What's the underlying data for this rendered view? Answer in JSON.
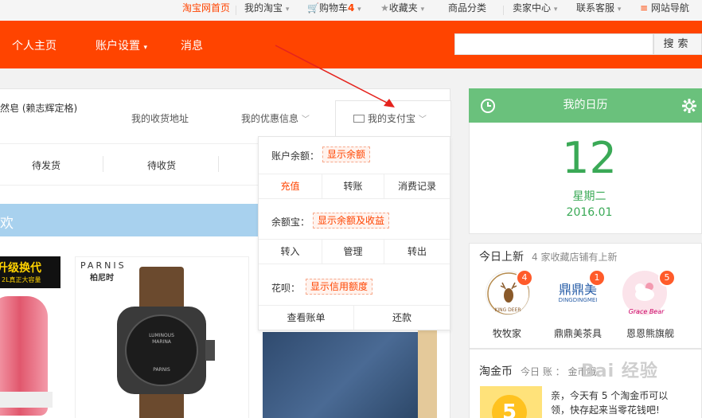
{
  "topbar": {
    "home": "淘宝网首页",
    "my_taobao": "我的淘宝",
    "cart": "购物车",
    "cart_count": "4",
    "favorites": "收藏夹",
    "categories": "商品分类",
    "seller": "卖家中心",
    "support": "联系客服",
    "sitenav": "网站导航"
  },
  "nav": {
    "home": "个人主页",
    "settings": "账户设置",
    "messages": "消息",
    "search_value": "",
    "search_button": "搜索"
  },
  "profile": {
    "username": "然皂 (赖志辉定格)",
    "tabs": [
      "我的收货地址",
      "我的优惠信息",
      "我的支付宝"
    ]
  },
  "orders": [
    "待发货",
    "待收货"
  ],
  "banner_text": "欢",
  "alipay_dropdown": {
    "balance_label": "账户余额：",
    "balance_badge": "显示余额",
    "balance_actions": [
      "充值",
      "转账",
      "消费记录"
    ],
    "yuebao_label": "余额宝：",
    "yuebao_badge": "显示余额及收益",
    "yuebao_actions": [
      "转入",
      "管理",
      "转出"
    ],
    "huabei_label": "花呗：",
    "huabei_badge": "显示信用额度",
    "huabei_actions": [
      "查看账单",
      "还款"
    ]
  },
  "products": {
    "p1_text": "升级换代",
    "p1_sub": "2L真正大容量",
    "p2_brand": "PARNIS",
    "p2_brand_cn": "柏尼时",
    "p2_dial1": "LUMINOUS",
    "p2_dial2": "MARINA",
    "p2_dial3": "PARNIS"
  },
  "calendar": {
    "title": "我的日历",
    "day": "12",
    "weekday": "星期二",
    "year_month": "2016.01"
  },
  "new_today": {
    "title": "今日上新",
    "subtitle": "4 家收藏店铺有上新",
    "shops": [
      {
        "name": "牧牧家",
        "count": "4",
        "logo": "KING DEER"
      },
      {
        "name": "鼎鼎美茶具",
        "count": "1",
        "logo_cn": "鼎鼎美",
        "logo": "DINGDINGMEI"
      },
      {
        "name": "恩恩熊旗舰",
        "count": "5",
        "logo": "Grace Bear"
      }
    ]
  },
  "coins": {
    "title": "淘金币",
    "sub": "今日  账   ：   金币哦",
    "line1": "亲，今天有 5 个淘金币可以",
    "line1_highlight": "5",
    "line2": "领，快存起来当零花钱吧!",
    "badge": "5"
  },
  "watermark": "Bai 经验",
  "colors": {
    "brand_orange": "#ff4400",
    "calendar_green": "#6ac17c",
    "banner_blue": "#a8d1ee",
    "badge_red": "#ff5b2a",
    "arrow_red": "#e5231d"
  }
}
